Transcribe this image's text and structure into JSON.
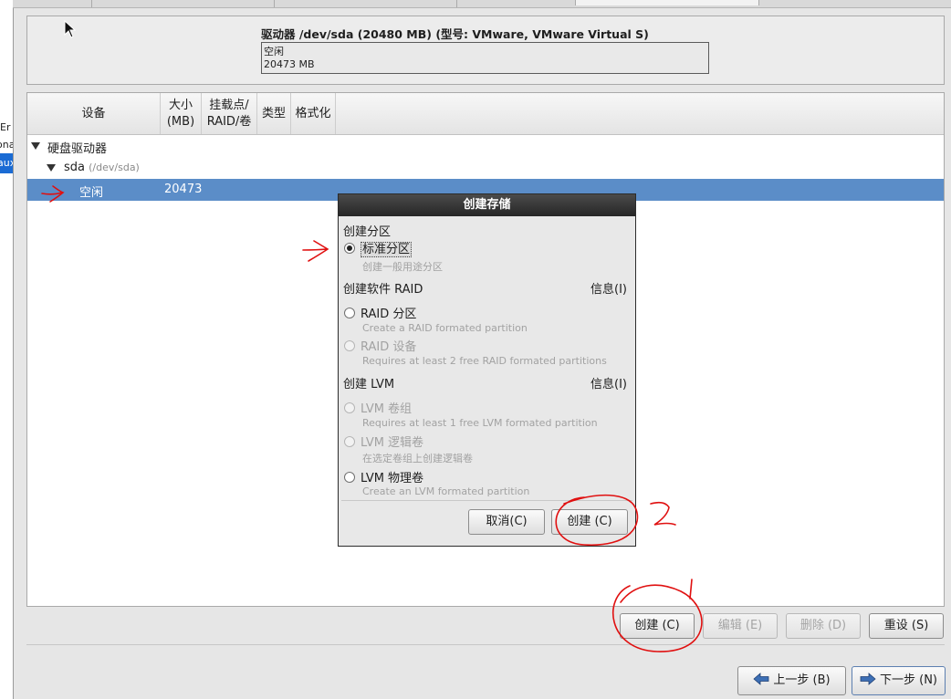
{
  "left_strip": {
    "fragments": [
      "Er",
      "ona",
      "aux"
    ]
  },
  "drive": {
    "title": "驱动器 /dev/sda (20480 MB) (型号: VMware, VMware Virtual S)",
    "bar_label": "空闲",
    "bar_size": "20473 MB"
  },
  "table": {
    "columns": {
      "device": "设备",
      "size_line1": "大小",
      "size_line2": "(MB)",
      "mount_line1": "挂载点/",
      "mount_line2": "RAID/卷",
      "type": "类型",
      "format": "格式化"
    },
    "rows": {
      "hard_drives": "硬盘驱动器",
      "sda_name": "sda",
      "sda_path": "(/dev/sda)",
      "free_name": "空闲",
      "free_size": "20473"
    }
  },
  "dialog": {
    "title": "创建存储",
    "section_partition": "创建分区",
    "opt_standard": "标准分区",
    "desc_standard": "创建一般用途分区",
    "section_raid": "创建软件 RAID",
    "info_raid": "信息(I)",
    "opt_raid_partition": "RAID 分区",
    "desc_raid_partition": "Create a RAID formated partition",
    "opt_raid_device": "RAID 设备",
    "desc_raid_device": "Requires at least 2 free RAID formated partitions",
    "section_lvm": "创建 LVM",
    "info_lvm": "信息(I)",
    "opt_lvm_vg": "LVM 卷组",
    "desc_lvm_vg": "Requires at least 1 free LVM formated partition",
    "opt_lvm_lv": "LVM 逻辑卷",
    "desc_lvm_lv": "在选定卷组上创建逻辑卷",
    "opt_lvm_pv": "LVM 物理卷",
    "desc_lvm_pv": "Create an LVM formated partition",
    "cancel_label": "取消(C)",
    "create_label": "创建 (C)"
  },
  "actions": {
    "create": "创建 (C)",
    "edit": "编辑 (E)",
    "delete": "删除 (D)",
    "reset": "重设 (S)"
  },
  "nav": {
    "back": "上一步 (B)",
    "next": "下一步 (N)"
  },
  "annotations": {
    "mark_1": "1",
    "mark_2": "2"
  },
  "colors": {
    "selection": "#5b8dc8",
    "annotation": "#e01010",
    "dialog_title": "#2f2f2f"
  }
}
